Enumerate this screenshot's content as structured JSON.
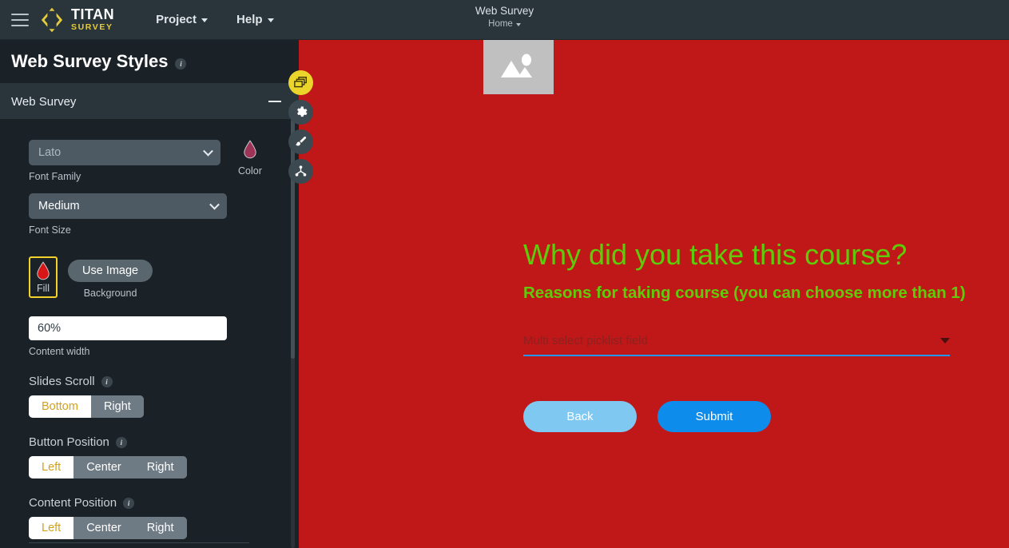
{
  "topbar": {
    "menu_icon": "hamburger-icon",
    "brand_primary": "TITAN",
    "brand_secondary": "SURVEY",
    "nav": [
      {
        "label": "Project",
        "icon": "chevron-down-icon"
      },
      {
        "label": "Help",
        "icon": "chevron-down-icon"
      }
    ],
    "document_title": "Web Survey",
    "document_breadcrumb": "Home"
  },
  "sidebar": {
    "title": "Web Survey Styles",
    "title_info": "i",
    "accordion": {
      "label": "Web Survey",
      "collapse_icon": "minus-icon"
    },
    "font_family": {
      "value": "Lato",
      "label": "Font Family",
      "is_placeholder": true
    },
    "color": {
      "label": "Color",
      "icon": "drop-icon",
      "hex": "#9e3358"
    },
    "font_size": {
      "value": "Medium",
      "label": "Font Size"
    },
    "background": {
      "label": "Background",
      "fill": {
        "label": "Fill",
        "icon": "drop-icon",
        "hex": "#d81616",
        "selected": true,
        "highlight_hex": "#f2d12b"
      },
      "use_image_label": "Use Image"
    },
    "content_width": {
      "value": "60%",
      "placeholder": "Content width",
      "label": "Content width"
    },
    "slides_scroll": {
      "label": "Slides Scroll",
      "info": "i",
      "options": [
        "Bottom",
        "Right"
      ],
      "selected": "Bottom"
    },
    "button_position": {
      "label": "Button Position",
      "info": "i",
      "options": [
        "Left",
        "Center",
        "Right"
      ],
      "selected": "Left"
    },
    "content_position": {
      "label": "Content Position",
      "info": "i",
      "options": [
        "Left",
        "Center",
        "Right"
      ],
      "selected": "Left"
    }
  },
  "tool_rail": [
    {
      "name": "duplicate-icon",
      "active": true
    },
    {
      "name": "gear-icon",
      "active": false
    },
    {
      "name": "brush-icon",
      "active": false
    },
    {
      "name": "node-tree-icon",
      "active": false
    }
  ],
  "canvas": {
    "background_hex": "#c01818",
    "image_placeholder": "image-placeholder-icon",
    "heading": "Why did you take this course?",
    "subheading": "Reasons for taking course (you can choose more than 1)",
    "heading_color": "#5ecc09",
    "picklist": {
      "placeholder": "Multi select picklist field",
      "arrow_icon": "caret-down-icon",
      "underline_hex": "#2196f3"
    },
    "buttons": [
      {
        "label": "Back",
        "hex": "#7ec8f2"
      },
      {
        "label": "Submit",
        "hex": "#0d8ceb"
      }
    ]
  }
}
